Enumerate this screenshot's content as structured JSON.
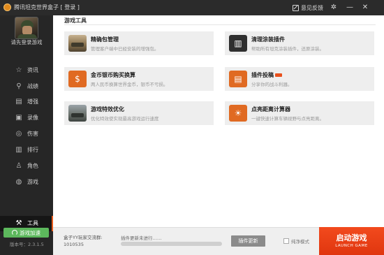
{
  "window": {
    "title": "腾讯坦克世界盒子 [ 登录 ]",
    "feedback_label": "意见反馈",
    "settings_icon": "gear-icon",
    "minimize_icon": "minimize-icon",
    "close_icon": "close-icon"
  },
  "profile": {
    "login_prompt": "请先登录游戏"
  },
  "sidebar": {
    "items": [
      {
        "label": "资讯",
        "icon": "star-icon",
        "glyph": "☆"
      },
      {
        "label": "战绩",
        "icon": "search-icon",
        "glyph": "⚲"
      },
      {
        "label": "增强",
        "icon": "boost-icon",
        "glyph": "▤"
      },
      {
        "label": "录像",
        "icon": "video-icon",
        "glyph": "▣"
      },
      {
        "label": "伤害",
        "icon": "damage-icon",
        "glyph": "◎"
      },
      {
        "label": "排行",
        "icon": "ranking-icon",
        "glyph": "▥"
      },
      {
        "label": "角色",
        "icon": "user-icon",
        "glyph": "♙"
      },
      {
        "label": "游戏",
        "icon": "gamepad-icon",
        "glyph": "◍"
      },
      {
        "label": "工具",
        "icon": "wrench-icon",
        "glyph": "🔧",
        "active": true
      }
    ],
    "accelerator_label": "游戏加速",
    "version": "版本号：2.3.1.5"
  },
  "section": {
    "title": "游戏工具"
  },
  "tools": [
    {
      "title": "精确包管理",
      "desc": "管理客户端中已经安装的增强包。",
      "icon": "tank-icon",
      "glyph": ""
    },
    {
      "title": "清理涂装插件",
      "desc": "帮助所有坦克涂装插件，还原涂装。",
      "icon": "trash-icon",
      "glyph": "🗑"
    },
    {
      "title": "金币银币购买换算",
      "desc": "两人民币换算世界金币，银币不亏损。",
      "icon": "coin-bag-icon",
      "glyph": "$"
    },
    {
      "title": "插件投稿",
      "desc": "分享你的战斗利器。",
      "icon": "upload-icon",
      "glyph": "✎",
      "badge": true
    },
    {
      "title": "游戏特效优化",
      "desc": "优化特效使实现最高游戏运行速度",
      "icon": "tank-effects-icon",
      "glyph": ""
    },
    {
      "title": "点亮距离计算器",
      "desc": "一键快速计算车辆视野与点亮距离。",
      "icon": "lightbulb-icon",
      "glyph": "💡"
    }
  ],
  "bottom": {
    "qq_group_label": "盒子YY玩家交流群:",
    "qq_group_number": "1010535",
    "update_status": "插件更新未进行……",
    "update_progress": 0,
    "update_button_label": "插件更新",
    "pure_mode_label": "纯净模式",
    "pure_mode_checked": false,
    "launch_label": "启动游戏",
    "launch_sublabel": "LAUNCH GAME"
  },
  "colors": {
    "sidebar_bg": "#262626",
    "accent_orange": "#e8591a",
    "launch_red": "#f24a1d",
    "accelerator_green": "#5cb85c"
  }
}
